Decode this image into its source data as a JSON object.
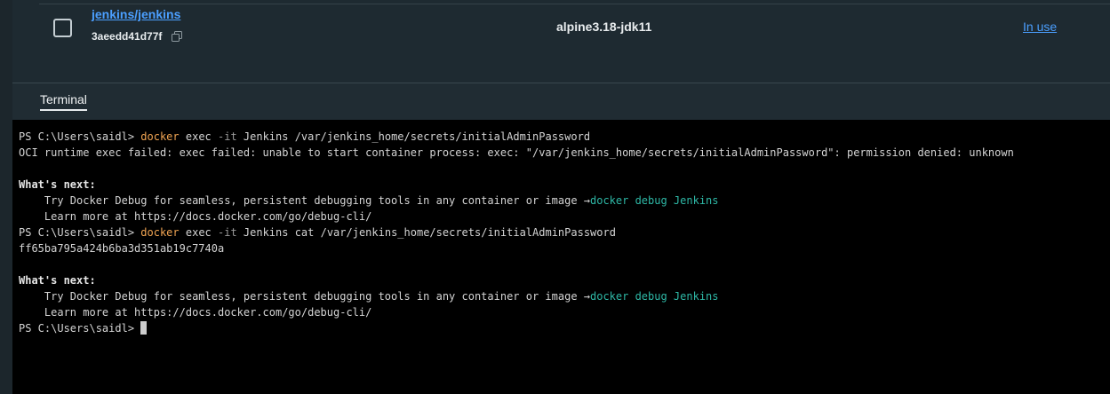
{
  "image_row": {
    "repository": "jenkins/jenkins",
    "image_id": "3aeedd41d77f",
    "tag": "alpine3.18-jdk11",
    "status": "In use"
  },
  "tabs": {
    "terminal": "Terminal"
  },
  "terminal": {
    "lines": [
      {
        "prompt": "PS C:\\Users\\saidl> ",
        "cmd": "docker",
        "seg1": " exec ",
        "flag": "-it",
        "seg2": " Jenkins /var/jenkins_home/secrets/initialAdminPassword"
      },
      {
        "text": "OCI runtime exec failed: exec failed: unable to start container process: exec: \"/var/jenkins_home/secrets/initialAdminPassword\": permission denied: unknown"
      },
      {
        "text": ""
      },
      {
        "heading": "What's next:"
      },
      {
        "text": "    Try Docker Debug for seamless, persistent debugging tools in any container or image →",
        "hint": "docker debug Jenkins"
      },
      {
        "text": "    Learn more at https://docs.docker.com/go/debug-cli/"
      },
      {
        "prompt": "PS C:\\Users\\saidl> ",
        "cmd": "docker",
        "seg1": " exec ",
        "flag": "-it",
        "seg2": " Jenkins cat /var/jenkins_home/secrets/initialAdminPassword"
      },
      {
        "text": "ff65ba795a424b6ba3d351ab19c7740a"
      },
      {
        "text": ""
      },
      {
        "heading": "What's next:"
      },
      {
        "text": "    Try Docker Debug for seamless, persistent debugging tools in any container or image →",
        "hint": "docker debug Jenkins"
      },
      {
        "text": "    Learn more at https://docs.docker.com/go/debug-cli/"
      },
      {
        "prompt": "PS C:\\Users\\saidl> ",
        "cursor": true
      }
    ]
  },
  "icons": {
    "copy": "copy-icon",
    "cursor": "terminal-cursor"
  },
  "colors": {
    "link": "#4b9fff",
    "terminal_bg": "#000000",
    "command": "#f0a452",
    "hint_link": "#2eb8a6",
    "panel_bg": "#202c33"
  }
}
